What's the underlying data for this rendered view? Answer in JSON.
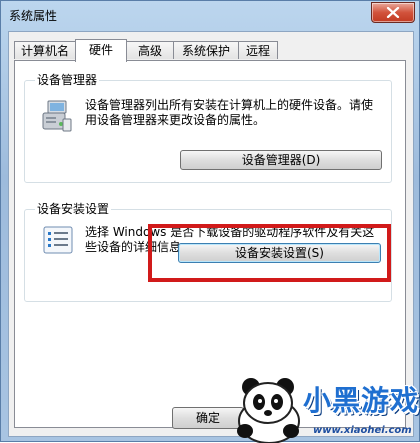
{
  "window": {
    "title": "系统属性"
  },
  "tabs": [
    {
      "label": "计算机名"
    },
    {
      "label": "硬件"
    },
    {
      "label": "高级"
    },
    {
      "label": "系统保护"
    },
    {
      "label": "远程"
    }
  ],
  "device_manager": {
    "group_title": "设备管理器",
    "description_line1": "设备管理器列出所有安装在计算机上的硬件设备。请使",
    "description_line2": "用设备管理器来更改设备的属性。",
    "button_label": "设备管理器(D)"
  },
  "device_install": {
    "group_title": "设备安装设置",
    "description_line1": "选择 Windows 是否下载设备的驱动程序软件及有关这",
    "description_line2": "些设备的详细信息。",
    "button_label": "设备安装设置(S)"
  },
  "footer": {
    "ok_label": "确定"
  },
  "watermark": {
    "brand": "小黑游戏",
    "url": "www.xiaohei.com"
  },
  "colors": {
    "highlight": "#d11a1a",
    "watermark_blue": "#1f6fd0"
  }
}
